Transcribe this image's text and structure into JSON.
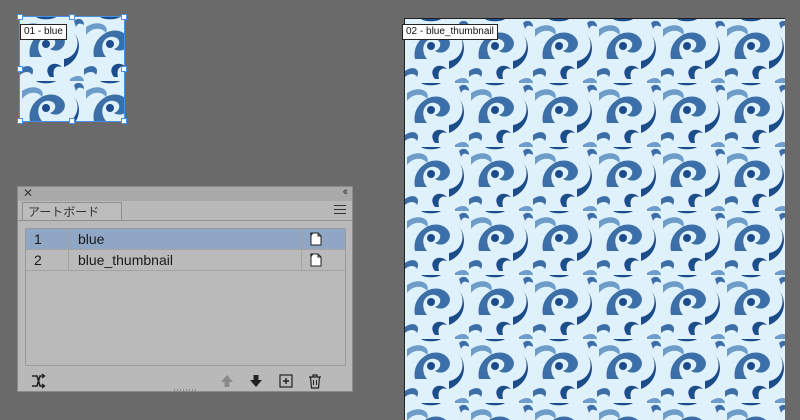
{
  "artboards": [
    {
      "label": "01 - blue",
      "selected": true
    },
    {
      "label": "02 - blue_thumbnail",
      "selected": false
    }
  ],
  "pattern": {
    "background": "#dff1fb",
    "light": "#6f9dc9",
    "mid": "#3c6ea8",
    "dark": "#1c4c8c"
  },
  "panel": {
    "tab_label": "アートボード",
    "close_glyph": "✕",
    "collapse_glyph": "‹‹",
    "rows": [
      {
        "number": "1",
        "name": "blue",
        "selected": true
      },
      {
        "number": "2",
        "name": "blue_thumbnail",
        "selected": false
      }
    ],
    "icons": [
      "rearrange-icon",
      "move-up-icon",
      "move-down-icon",
      "new-artboard-icon",
      "delete-icon"
    ]
  },
  "colors": {
    "selection": "#4a90e2",
    "canvas": "#6a6a6a",
    "row_selected": "#8fa6c4"
  }
}
